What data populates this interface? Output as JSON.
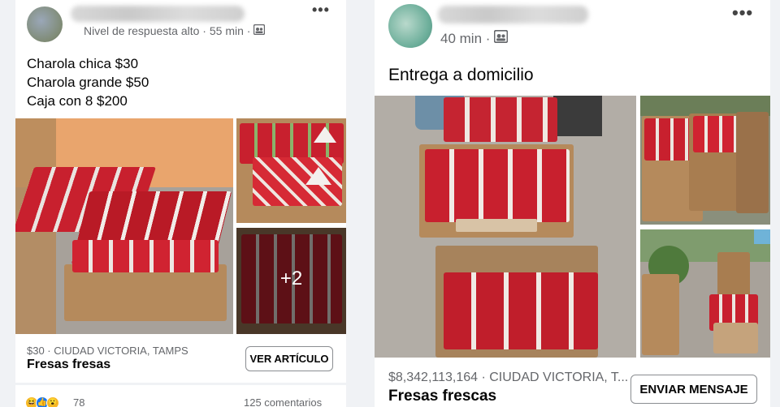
{
  "colors": {
    "background": "#f0f2f5",
    "card": "#ffffff",
    "secondary_text": "#65676b",
    "wall": "#e9a56d",
    "strawberry": "#c8202e",
    "cardboard": "#b58a5c",
    "ground": "#a7a19a"
  },
  "left_post": {
    "meta_text": "Nivel de respuesta alto · 55 min ·",
    "icons": [
      "group-icon",
      "more-options-icon"
    ],
    "lines": [
      "Charola chica $30",
      "Charola grande $50",
      "Caja con 8 $200"
    ],
    "more_photos": "+2",
    "price_location": "$30 · CIUDAD VICTORIA, TAMPS",
    "title": "Fresas fresas",
    "button": "VER ARTÍCULO",
    "reactions_count": "78",
    "comments": "125 comentarios"
  },
  "right_post": {
    "meta_text": "40 min ·",
    "icons": [
      "group-icon",
      "more-options-icon"
    ],
    "lines": [
      "Entrega a domicilio"
    ],
    "price_location": "$8,342,113,164 · CIUDAD VICTORIA, T...",
    "title": "Fresas frescas",
    "button": "ENVIAR MENSAJE"
  }
}
